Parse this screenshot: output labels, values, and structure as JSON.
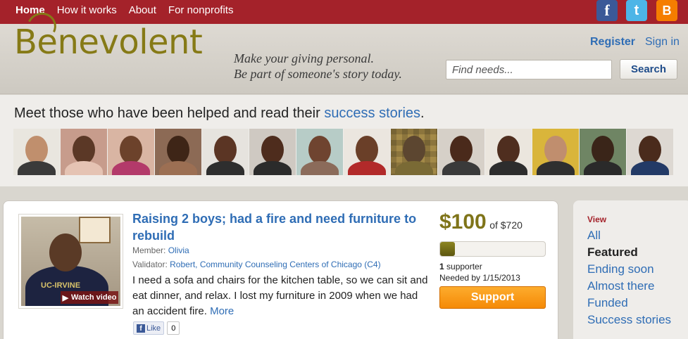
{
  "nav": {
    "items": [
      {
        "label": "Home",
        "active": true
      },
      {
        "label": "How it works"
      },
      {
        "label": "About"
      },
      {
        "label": "For nonprofits"
      }
    ],
    "social": [
      "facebook-icon",
      "twitter-icon",
      "blogger-icon"
    ]
  },
  "header": {
    "logo_text": "Benevolent",
    "tagline_1": "Make your giving personal.",
    "tagline_2": "Be part of someone's story today.",
    "register": "Register",
    "signin": "Sign in",
    "search_placeholder": "Find needs...",
    "search_button": "Search"
  },
  "stories": {
    "prefix": "Meet those who have been helped and read their ",
    "link": "success stories",
    "suffix": ".",
    "faces": 14
  },
  "need": {
    "title": "Raising 2 boys; had a fire and need furniture to rebuild",
    "member_label": "Member: ",
    "member_name": "Olivia",
    "validator_label": "Validator: ",
    "validator_name": "Robert, Community Counseling Centers of Chicago (C4)",
    "description": "I need a sofa and chairs for the kitchen table, so we can sit and eat dinner, and relax. I lost my furniture in 2009 when we had an accident fire.",
    "more": "More",
    "watch_video": "Watch video",
    "like": "Like",
    "like_count": "0",
    "amount": "$100",
    "goal": "of $720",
    "progress": 0.139,
    "supporters_count": "1",
    "supporters_label": " supporter",
    "needed_by": "Needed by 1/15/2013",
    "support_button": "Support"
  },
  "filter": {
    "title": "View",
    "items": [
      {
        "label": "All"
      },
      {
        "label": "Featured",
        "active": true
      },
      {
        "label": "Ending soon"
      },
      {
        "label": "Almost there"
      },
      {
        "label": "Funded"
      },
      {
        "label": "Success stories"
      }
    ]
  },
  "colors": {
    "nav_bg": "#a4222a",
    "brand_olive": "#867a16",
    "link_blue": "#2f6db5",
    "support_orange": "#f58a07"
  }
}
